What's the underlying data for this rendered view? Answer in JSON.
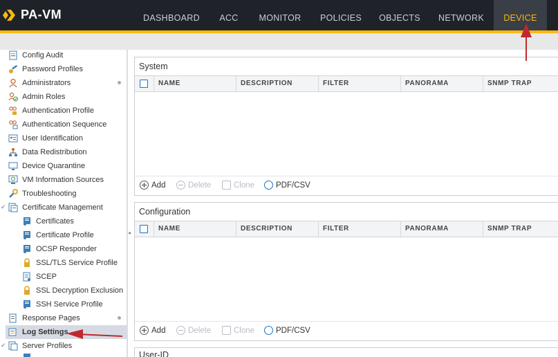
{
  "app": {
    "logo_text": "PA-VM"
  },
  "nav": {
    "items": [
      {
        "label": "DASHBOARD"
      },
      {
        "label": "ACC"
      },
      {
        "label": "MONITOR"
      },
      {
        "label": "POLICIES"
      },
      {
        "label": "OBJECTS"
      },
      {
        "label": "NETWORK"
      },
      {
        "label": "DEVICE"
      }
    ],
    "active": "DEVICE"
  },
  "sidebar": {
    "items": [
      {
        "label": "Config Audit",
        "icon": "config-audit-icon"
      },
      {
        "label": "Password Profiles",
        "icon": "key-icon"
      },
      {
        "label": "Administrators",
        "icon": "user-icon"
      },
      {
        "label": "Admin Roles",
        "icon": "user-check-icon"
      },
      {
        "label": "Authentication Profile",
        "icon": "users-lock-icon"
      },
      {
        "label": "Authentication Sequence",
        "icon": "users-sequence-icon"
      },
      {
        "label": "User Identification",
        "icon": "id-card-icon"
      },
      {
        "label": "Data Redistribution",
        "icon": "network-tree-icon"
      },
      {
        "label": "Device Quarantine",
        "icon": "monitor-icon"
      },
      {
        "label": "VM Information Sources",
        "icon": "vm-icon"
      },
      {
        "label": "Troubleshooting",
        "icon": "wrench-icon"
      },
      {
        "label": "Certificate Management",
        "icon": "certificate-folder-icon"
      },
      {
        "label": "Certificates",
        "icon": "certificate-icon"
      },
      {
        "label": "Certificate Profile",
        "icon": "certificate-icon"
      },
      {
        "label": "OCSP Responder",
        "icon": "certificate-icon"
      },
      {
        "label": "SSL/TLS Service Profile",
        "icon": "lock-icon"
      },
      {
        "label": "SCEP",
        "icon": "certificate-doc-icon"
      },
      {
        "label": "SSL Decryption Exclusion",
        "icon": "lock-icon"
      },
      {
        "label": "SSH Service Profile",
        "icon": "certificate-icon"
      },
      {
        "label": "Response Pages",
        "icon": "document-icon"
      },
      {
        "label": "Log Settings",
        "icon": "log-settings-icon"
      },
      {
        "label": "Server Profiles",
        "icon": "server-folder-icon"
      }
    ],
    "selected": "Log Settings"
  },
  "panels": [
    {
      "title": "System",
      "columns": [
        "NAME",
        "DESCRIPTION",
        "FILTER",
        "PANORAMA",
        "SNMP TRAP"
      ],
      "toolbar": {
        "add": "Add",
        "delete": "Delete",
        "clone": "Clone",
        "pdf": "PDF/CSV"
      }
    },
    {
      "title": "Configuration",
      "columns": [
        "NAME",
        "DESCRIPTION",
        "FILTER",
        "PANORAMA",
        "SNMP TRAP"
      ],
      "toolbar": {
        "add": "Add",
        "delete": "Delete",
        "clone": "Clone",
        "pdf": "PDF/CSV"
      }
    },
    {
      "title": "User-ID"
    }
  ],
  "colors": {
    "accent": "#fbb80f",
    "topbar": "#1f2329",
    "annotation": "#c0282d",
    "link": "#1a73c8"
  }
}
